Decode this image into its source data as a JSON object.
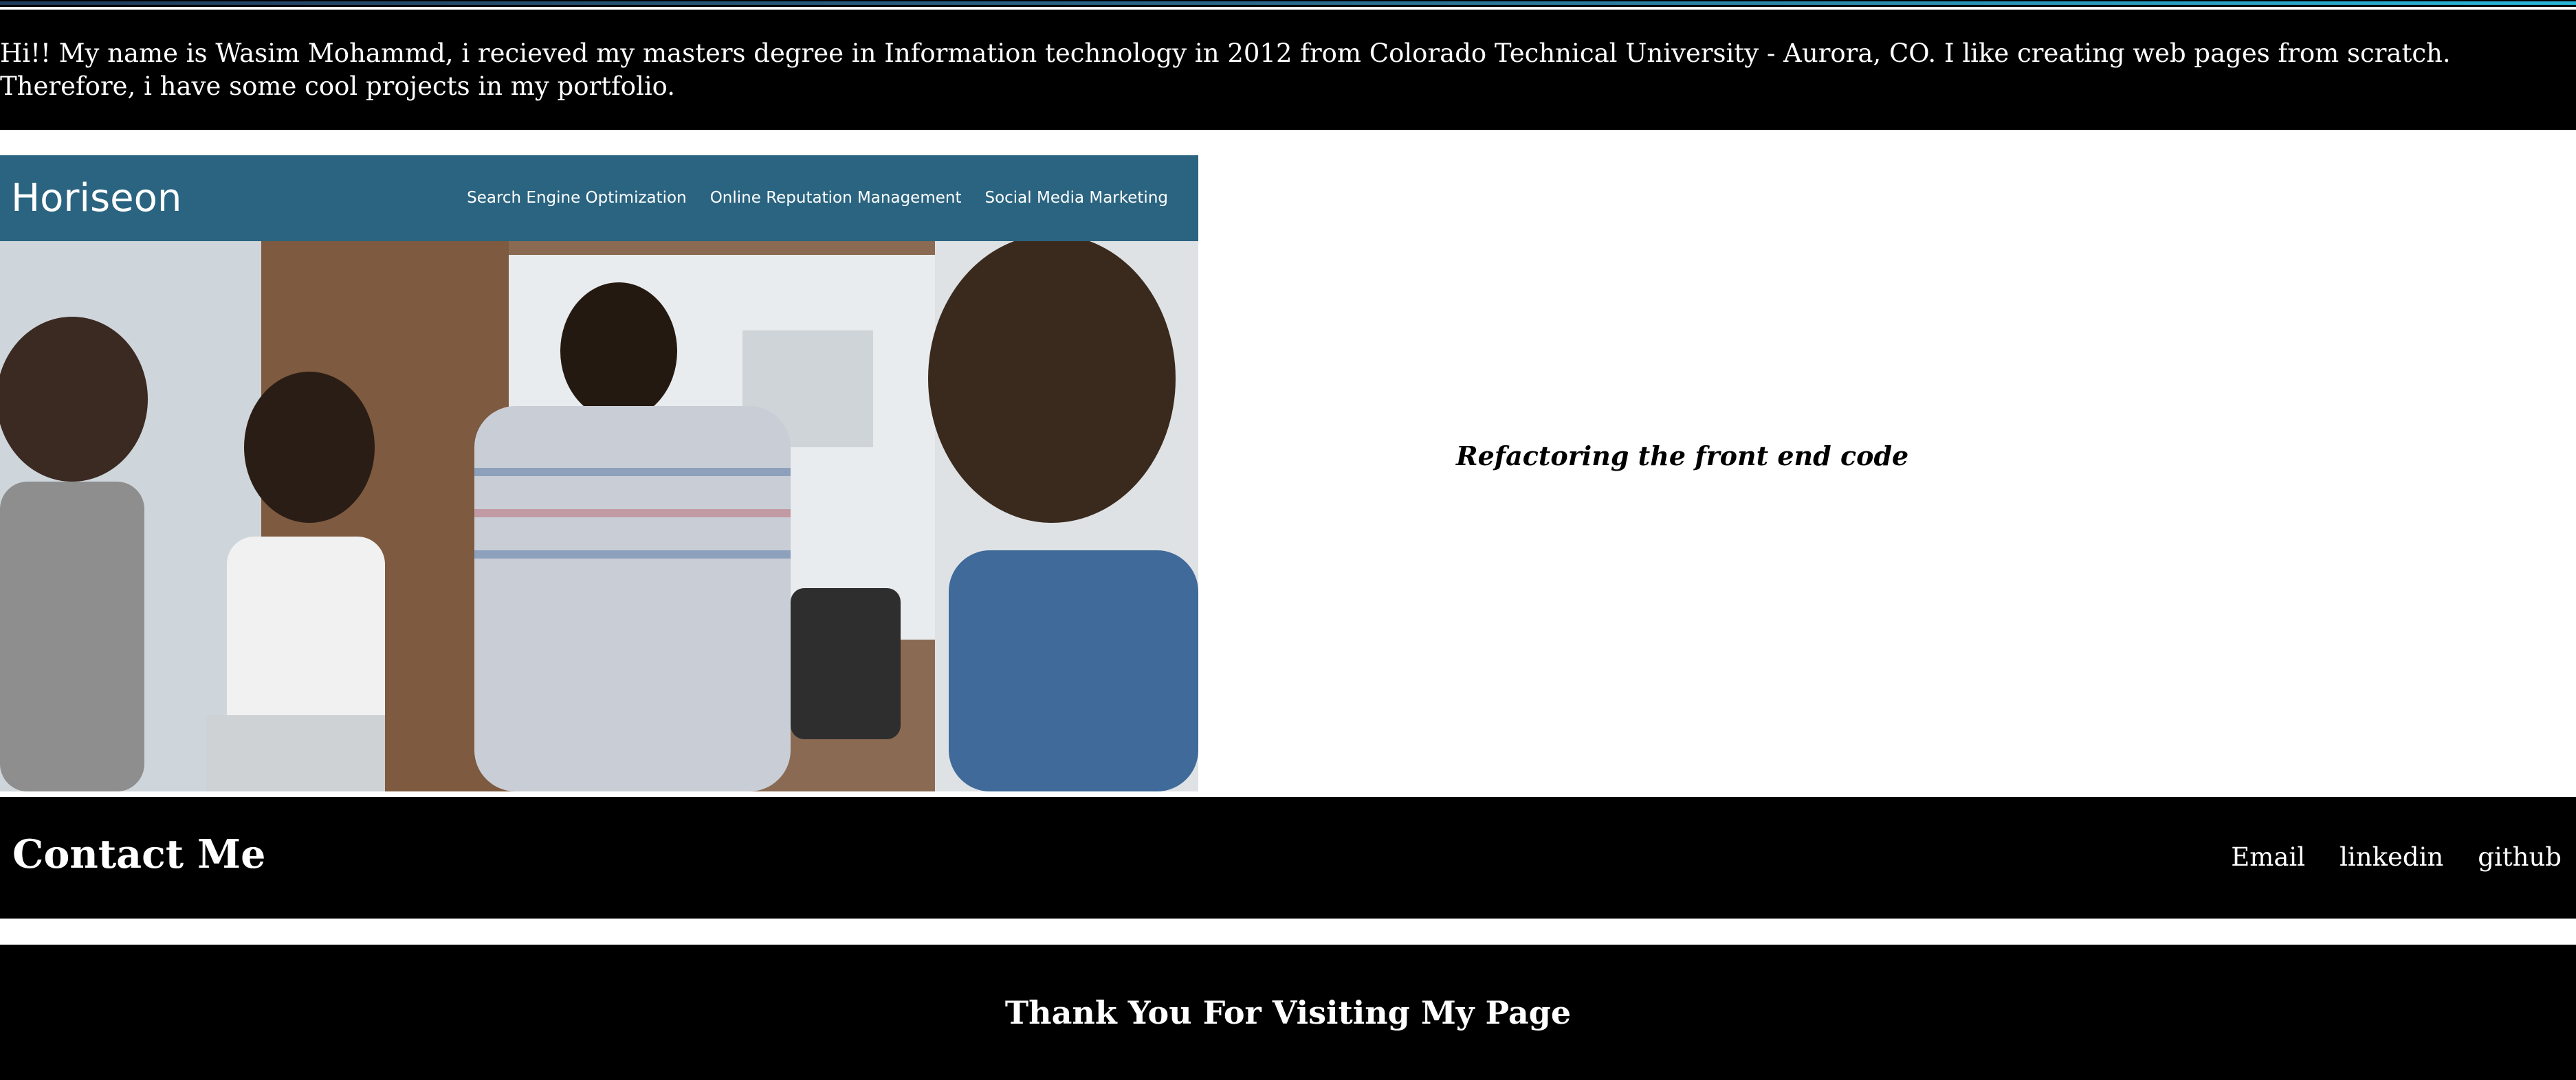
{
  "about": {
    "text": "Hi!! My name is Wasim Mohammd, i recieved my masters degree in Information technology in 2012 from Colorado Technical University - Aurora, CO. I like creating web pages from scratch. Therefore, i have some cool projects in my portfolio."
  },
  "project": {
    "screenshot": {
      "logo": "Horiseon",
      "nav": [
        "Search Engine Optimization",
        "Online Reputation Management",
        "Social Media Marketing"
      ]
    },
    "caption": "Refactoring the front end code"
  },
  "contact": {
    "title": "Contact Me",
    "links": [
      "Email",
      "linkedin",
      "github"
    ]
  },
  "footer": {
    "text": "Thank You For Visiting My Page"
  },
  "colors": {
    "band": "#000000",
    "text": "#ffffff",
    "horiseon_header": "#2a6480"
  }
}
